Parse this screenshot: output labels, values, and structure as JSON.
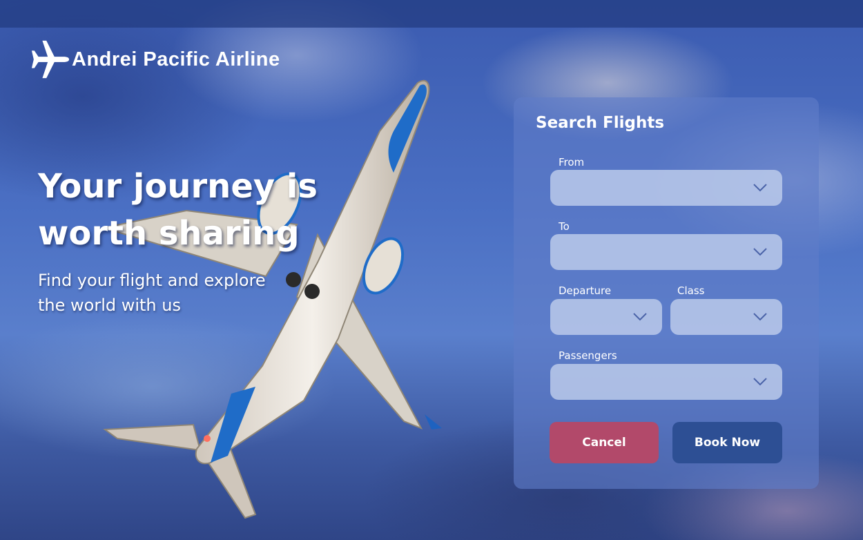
{
  "brand": {
    "name": "Andrei Pacific Airline",
    "logo_icon": "airplane-icon"
  },
  "hero": {
    "title": "Your journey is worth sharing",
    "subtitle": "Find your flight and explore the world with us"
  },
  "search": {
    "title": "Search Flights",
    "fields": {
      "from": {
        "label": "From",
        "value": ""
      },
      "to": {
        "label": "To",
        "value": ""
      },
      "departure": {
        "label": "Departure",
        "value": ""
      },
      "class": {
        "label": "Class",
        "value": ""
      },
      "passengers": {
        "label": "Passengers",
        "value": ""
      }
    },
    "cancel_label": "Cancel",
    "book_label": "Book Now"
  },
  "colors": {
    "cancel": "#b2496a",
    "book": "#2d4f94",
    "panel": "#5f7dc8",
    "sky": "#4b70c4"
  }
}
